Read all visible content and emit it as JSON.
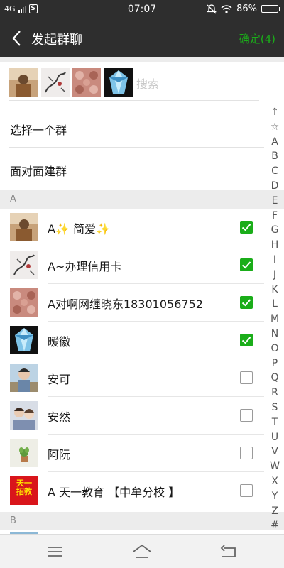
{
  "status_bar": {
    "network": "4G",
    "time": "07:07",
    "battery": "86%",
    "battery_level": 0.86
  },
  "header": {
    "title": "发起群聊",
    "confirm_label": "确定(4)"
  },
  "search": {
    "placeholder": "搜索"
  },
  "selected_thumbnails": [
    "avatar-portrait",
    "avatar-ink-painting",
    "avatar-pattern",
    "avatar-blue-gem"
  ],
  "options": [
    {
      "label": "选择一个群"
    },
    {
      "label": "面对面建群"
    }
  ],
  "sections": [
    {
      "letter": "A",
      "contacts": [
        {
          "name": "A✨ 简爱✨",
          "checked": true,
          "avatar": "portrait"
        },
        {
          "name": "A~办理信用卡",
          "checked": true,
          "avatar": "ink-painting"
        },
        {
          "name": "A对啊网缠晓东18301056752",
          "checked": true,
          "avatar": "pattern"
        },
        {
          "name": "暧徽",
          "checked": true,
          "avatar": "blue-gem"
        },
        {
          "name": "安可",
          "checked": false,
          "avatar": "child-photo"
        },
        {
          "name": "安然",
          "checked": false,
          "avatar": "couple-photo"
        },
        {
          "name": "阿阮",
          "checked": false,
          "avatar": "plant"
        },
        {
          "name": "A 天一教育 【中牟分校 】",
          "checked": false,
          "avatar": "red-logo"
        }
      ]
    },
    {
      "letter": "B",
      "contacts": []
    }
  ],
  "logo_text": {
    "line1": "天一",
    "line2": "招教"
  },
  "index_letters": [
    "↑",
    "☆",
    "A",
    "B",
    "C",
    "D",
    "E",
    "F",
    "G",
    "H",
    "I",
    "J",
    "K",
    "L",
    "M",
    "N",
    "O",
    "P",
    "Q",
    "R",
    "S",
    "T",
    "U",
    "V",
    "W",
    "X",
    "Y",
    "Z",
    "#"
  ],
  "colors": {
    "header_bg": "#2e2e2e",
    "accent_green": "#1aad19",
    "section_bg": "#ececec"
  }
}
